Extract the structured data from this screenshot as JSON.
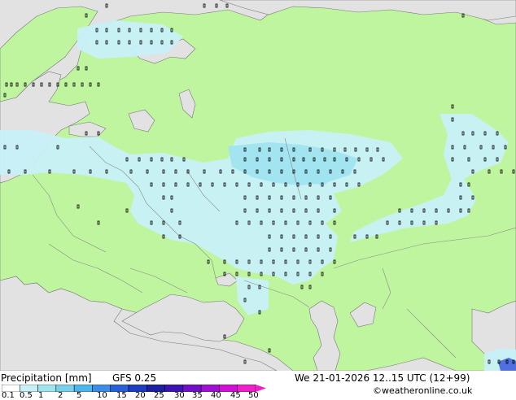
{
  "map": {
    "colors": {
      "sea": "#e2e2e2",
      "land": "#c0f5a0",
      "precip_light": "#c8f0f8",
      "precip_medium": "#a0e4f0",
      "precip_blue": "#5070e0",
      "borders": "#888888",
      "coast": "#777777",
      "marker": "#000000"
    }
  },
  "footer": {
    "title": "Precipitation [mm]",
    "model": "GFS 0.25",
    "datetime": "We 21-01-2026 12..15 UTC (12+99)",
    "credit": "©weatheronline.co.uk",
    "legend": {
      "ticks": [
        "0.1",
        "0.5",
        "1",
        "2",
        "5",
        "10",
        "15",
        "20",
        "25",
        "30",
        "35",
        "40",
        "45",
        "50"
      ],
      "colors": [
        "#ffffff",
        "#c8f0f8",
        "#a0e4f0",
        "#78d0ec",
        "#50b4ec",
        "#3c8ce6",
        "#2860d8",
        "#1e3cc0",
        "#1c20a0",
        "#3c14b4",
        "#7010c8",
        "#a010d0",
        "#d010d4",
        "#f020c8"
      ]
    }
  }
}
